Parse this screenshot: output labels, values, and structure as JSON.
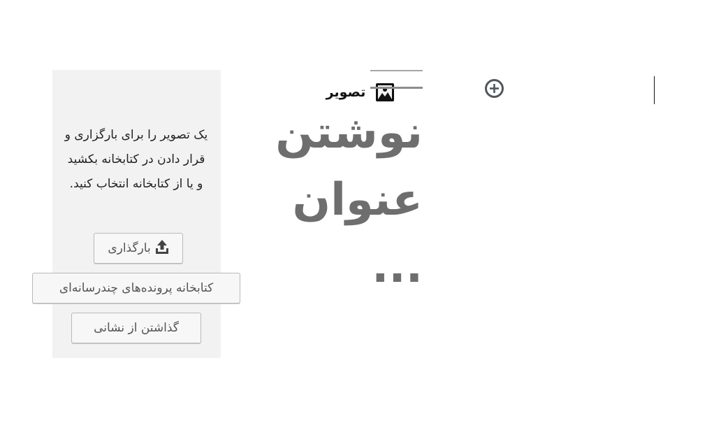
{
  "image_block": {
    "title": "تصویر",
    "icon": "image-icon",
    "instructions": "یک تصویر را برای بارگزاری و قرار دادن در کتابخانه بکشید و یا از کتابخانه انتخاب کنید.",
    "upload_label": "بارگذاری",
    "upload_icon": "upload-icon",
    "library_label": "کتابخانه پرونده‌های چندرسانه‌ای",
    "url_label": "گذاشتن از نشانی"
  },
  "post": {
    "title_placeholder": "نوشتن\nعنوان\n..."
  },
  "inserter": {
    "icon": "plus-circle-icon"
  }
}
